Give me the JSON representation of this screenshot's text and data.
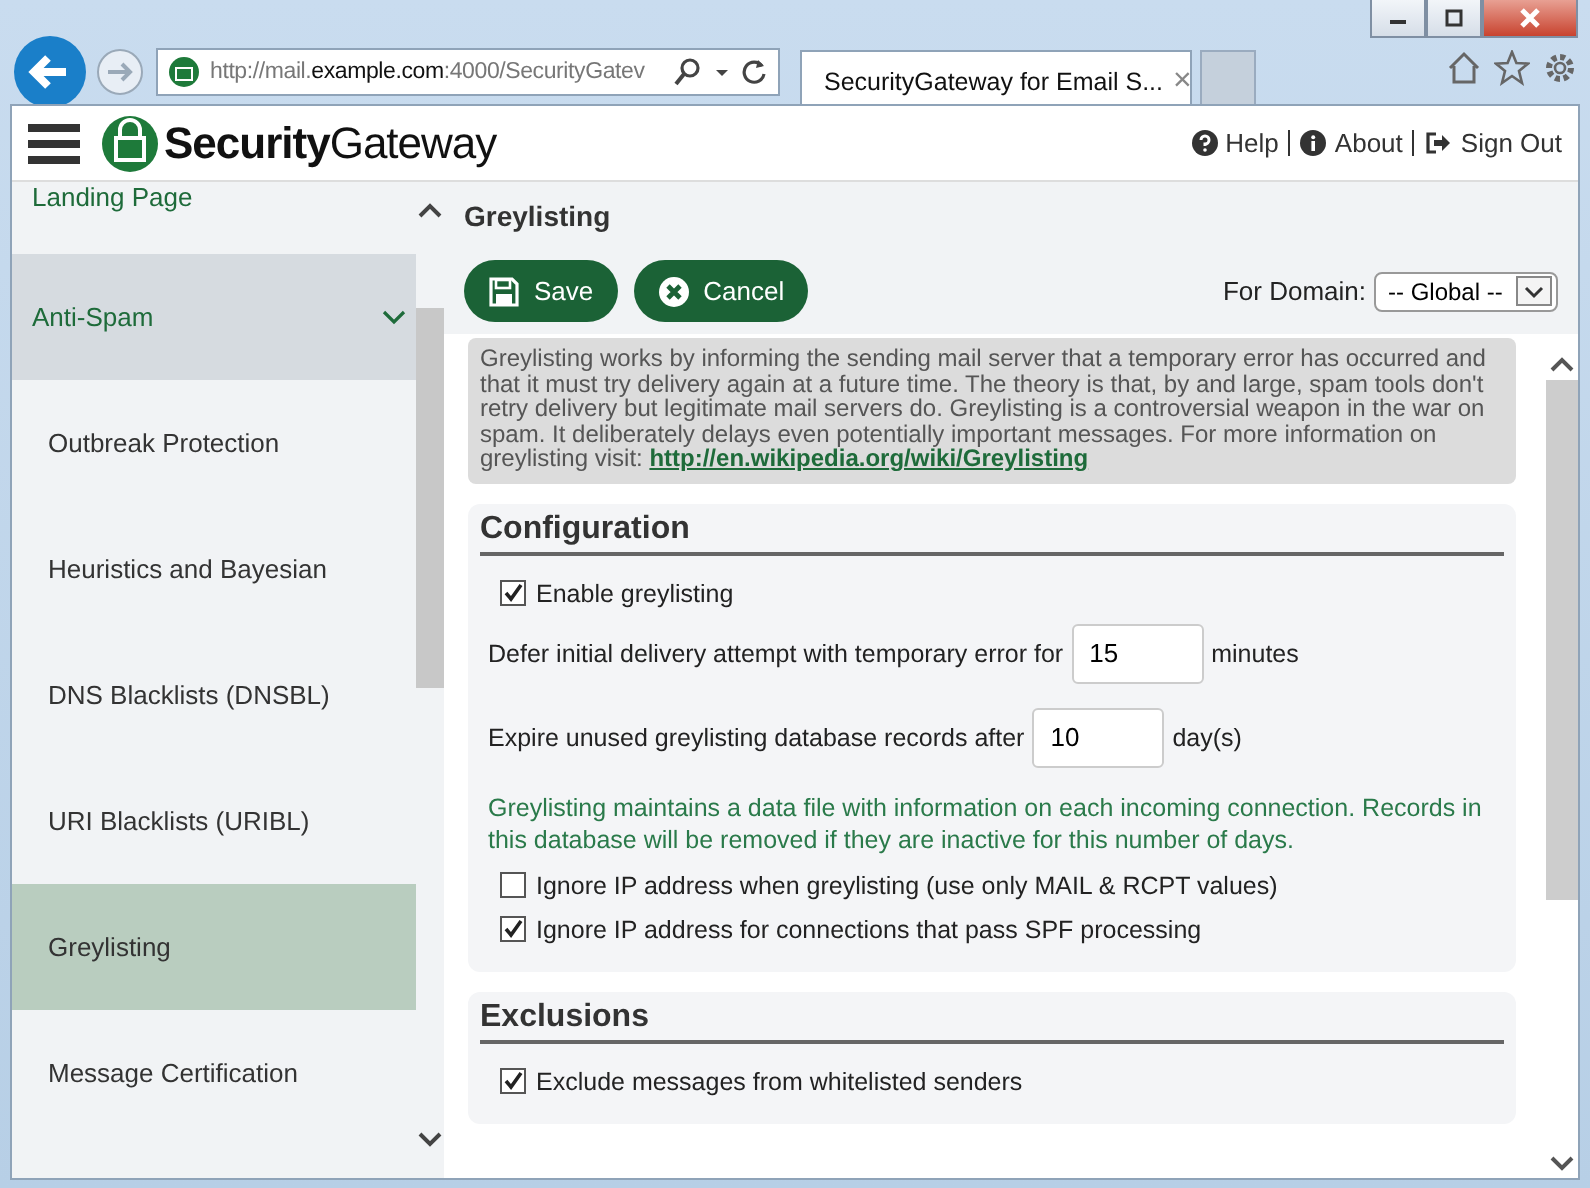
{
  "browser": {
    "address": "http://mail.**example.com**:4000/SecurityGatev",
    "tab_title": "SecurityGateway for Email S...",
    "tab_close": "×"
  },
  "header": {
    "logo_bold": "Security",
    "logo_light": "Gateway",
    "links": [
      "Help",
      "About",
      "Sign Out"
    ]
  },
  "sidebar": {
    "items": [
      {
        "label": "Landing Page",
        "kind": "top",
        "selected": false
      },
      {
        "label": "Anti-Spam",
        "kind": "section",
        "selected": false,
        "expanded": true
      },
      {
        "label": "Outbreak Protection",
        "kind": "sub",
        "selected": false
      },
      {
        "label": "Heuristics and Bayesian",
        "kind": "sub",
        "selected": false
      },
      {
        "label": "DNS Blacklists (DNSBL)",
        "kind": "sub",
        "selected": false
      },
      {
        "label": "URI Blacklists (URIBL)",
        "kind": "sub",
        "selected": false
      },
      {
        "label": "Greylisting",
        "kind": "sub",
        "selected": true
      },
      {
        "label": "Message Certification",
        "kind": "sub",
        "selected": false
      }
    ]
  },
  "page": {
    "title": "Greylisting",
    "buttons": [
      {
        "label": "Save",
        "kind": "save"
      },
      {
        "label": "Cancel",
        "kind": "cancel"
      }
    ],
    "domain": {
      "label": "For Domain:",
      "value": "-- Global --"
    },
    "description": {
      "text": "Greylisting works by informing the sending mail server that a temporary error has occurred and that it must try delivery again at a future time. The theory is that, by and large, spam tools don't retry delivery but legitimate mail servers do. Greylisting is a controversial weapon in the war on spam. It deliberately delays even potentially important messages. For more information on greylisting visit:",
      "link": "http://en.wikipedia.org/wiki/Greylisting"
    },
    "sections": [
      {
        "title": "Configuration",
        "rows": [
          {
            "kind": "checkbox",
            "label": "Enable greylisting",
            "checked": true
          },
          {
            "kind": "number",
            "label": "Defer initial delivery attempt with temporary error for",
            "value": "15",
            "unit": "minutes"
          },
          {
            "kind": "number",
            "label": "Expire unused greylisting database records after",
            "value": "10",
            "unit": "day(s)"
          },
          {
            "kind": "note",
            "label": "Greylisting maintains a data file with information on each incoming connection. Records in this database will be removed if they are inactive for this number of days."
          },
          {
            "kind": "checkbox",
            "label": "Ignore IP address when greylisting (use only MAIL & RCPT values)",
            "checked": false
          },
          {
            "kind": "checkbox",
            "label": "Ignore IP address for connections that pass SPF processing",
            "checked": true
          }
        ]
      },
      {
        "title": "Exclusions",
        "rows": [
          {
            "kind": "checkbox",
            "label": "Exclude messages from whitelisted senders",
            "checked": true
          }
        ]
      }
    ]
  }
}
